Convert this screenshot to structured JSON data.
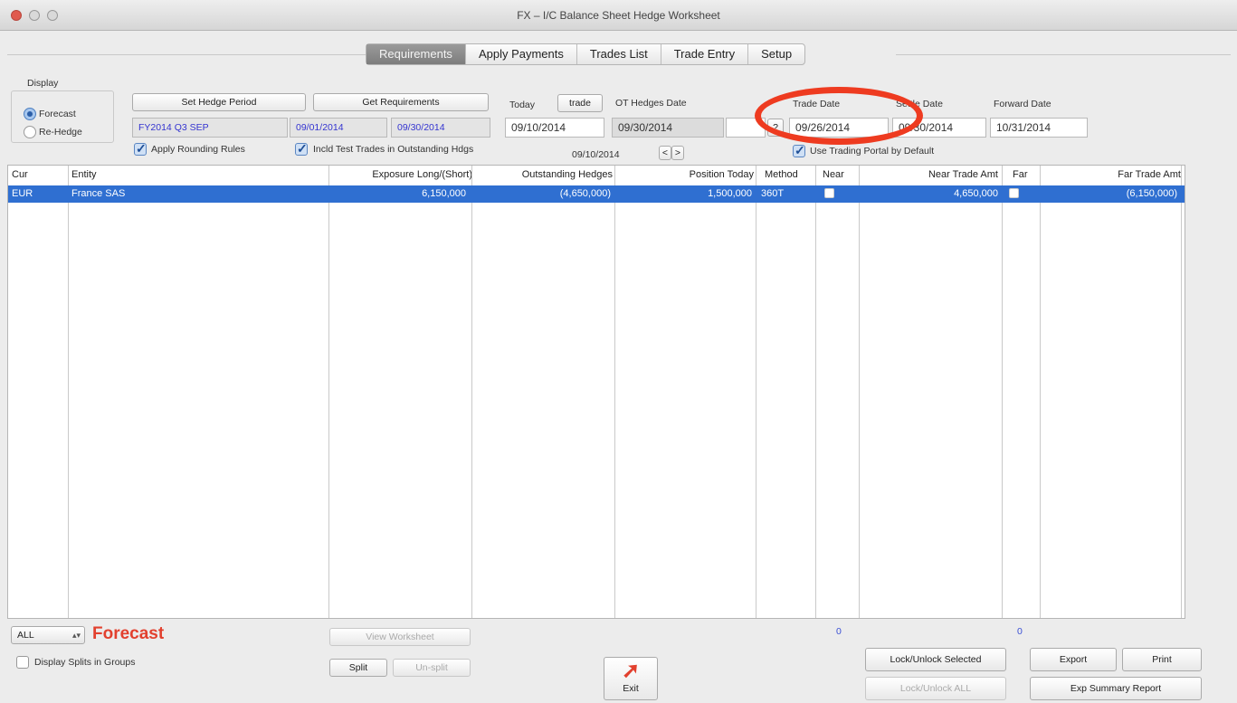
{
  "window": {
    "title": "FX – I/C Balance Sheet Hedge Worksheet"
  },
  "tabs": [
    {
      "label": "Requirements",
      "active": true
    },
    {
      "label": "Apply Payments"
    },
    {
      "label": "Trades List"
    },
    {
      "label": "Trade Entry"
    },
    {
      "label": "Setup"
    }
  ],
  "display": {
    "label": "Display",
    "options": [
      "Forecast",
      "Re-Hedge"
    ],
    "selected": "Forecast"
  },
  "hedge_period": {
    "set_button": "Set Hedge Period",
    "get_button": "Get Requirements",
    "period": "FY2014 Q3 SEP",
    "start": "09/01/2014",
    "end": "09/30/2014"
  },
  "checkboxes": {
    "rounding": "Apply Rounding Rules",
    "test_trades": "Incld Test Trades in Outstanding Hdgs",
    "trading_portal": "Use Trading Portal by Default"
  },
  "today": {
    "label": "Today",
    "button": "trade",
    "value": "09/10/2014"
  },
  "ot_hedges": {
    "label": "OT Hedges Date",
    "value": "09/30/2014"
  },
  "nav_date": {
    "value": "09/10/2014",
    "prev": "<",
    "next": ">"
  },
  "query_button": "?",
  "trade_date": {
    "label": "Trade Date",
    "value": "09/26/2014"
  },
  "settle_date": {
    "label": "Settle Date",
    "value": "09/30/2014"
  },
  "forward_date": {
    "label": "Forward Date",
    "value": "10/31/2014"
  },
  "table": {
    "columns": [
      "Cur",
      "Entity",
      "Exposure Long/(Short)",
      "Outstanding Hedges",
      "Position Today",
      "Method",
      "Near",
      "Near Trade Amt",
      "Far",
      "Far Trade Amt"
    ],
    "rows": [
      {
        "cur": "EUR",
        "entity": "France SAS",
        "exposure": "6,150,000",
        "outstanding": "(4,650,000)",
        "position": "1,500,000",
        "method": "360T",
        "near_trade_amt": "4,650,000",
        "far_trade_amt": "(6,150,000)"
      }
    ]
  },
  "footer": {
    "filter": "ALL",
    "mode_label": "Forecast",
    "display_splits": "Display Splits in Groups",
    "view_worksheet": "View Worksheet",
    "split": "Split",
    "unsplit": "Un-split",
    "exit": "Exit",
    "near_count": "0",
    "far_count": "0",
    "lock_selected": "Lock/Unlock Selected",
    "lock_all": "Lock/Unlock ALL",
    "export": "Export",
    "print": "Print",
    "exp_summary": "Exp Summary Report"
  },
  "colors": {
    "selection": "#2f6fd1",
    "accent_red": "#e2402e",
    "annotation": "#ee3b20"
  }
}
